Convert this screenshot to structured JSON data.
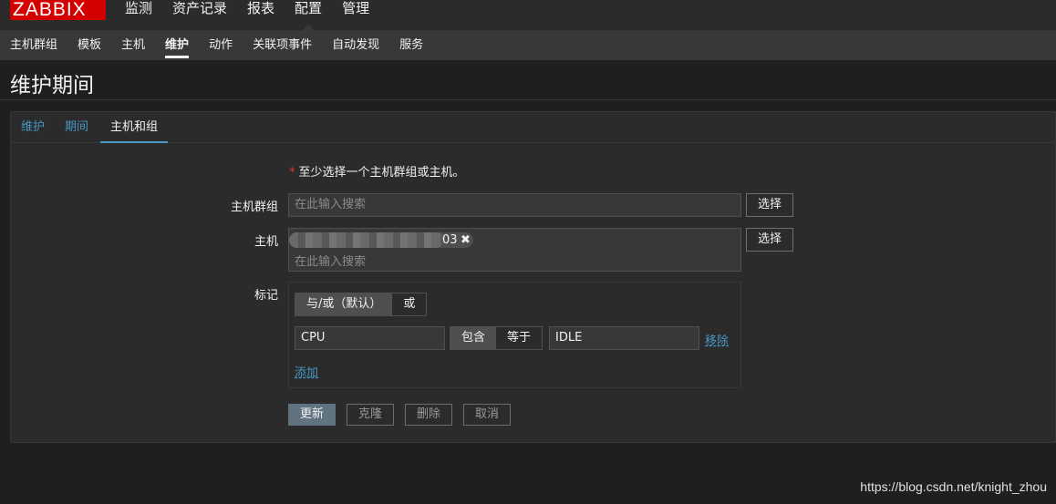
{
  "app": {
    "logo": "ZABBIX"
  },
  "top_menu": [
    "监测",
    "资产记录",
    "报表",
    "配置",
    "管理"
  ],
  "top_menu_selected": "配置",
  "sub_menu": [
    "主机群组",
    "模板",
    "主机",
    "维护",
    "动作",
    "关联项事件",
    "自动发现",
    "服务"
  ],
  "sub_menu_selected": "维护",
  "page_title": "维护期间",
  "tabs": [
    "维护",
    "期间",
    "主机和组"
  ],
  "active_tab": "主机和组",
  "form": {
    "required_note": "至少选择一个主机群组或主机。",
    "host_groups": {
      "label": "主机群组",
      "placeholder": "在此输入搜索",
      "select_button": "选择"
    },
    "hosts": {
      "label": "主机",
      "selected_host_visible_suffix": "03",
      "remove_chip": "✖",
      "placeholder": "在此输入搜索",
      "select_button": "选择"
    },
    "tags": {
      "label": "标记",
      "evaltype_options": [
        "与/或（默认）",
        "或"
      ],
      "evaltype_selected": "与/或（默认）",
      "rows": [
        {
          "tag": "CPU",
          "operators": [
            "包含",
            "等于"
          ],
          "operator_selected": "包含",
          "value": "IDLE",
          "remove": "移除"
        }
      ],
      "add": "添加"
    },
    "buttons": {
      "update": "更新",
      "clone": "克隆",
      "delete": "删除",
      "cancel": "取消"
    }
  },
  "watermark": "https://blog.csdn.net/knight_zhou",
  "colors": {
    "logo_bg": "#d40000",
    "link": "#4796c4",
    "required": "#e33734",
    "primary_button": "#60737e"
  }
}
